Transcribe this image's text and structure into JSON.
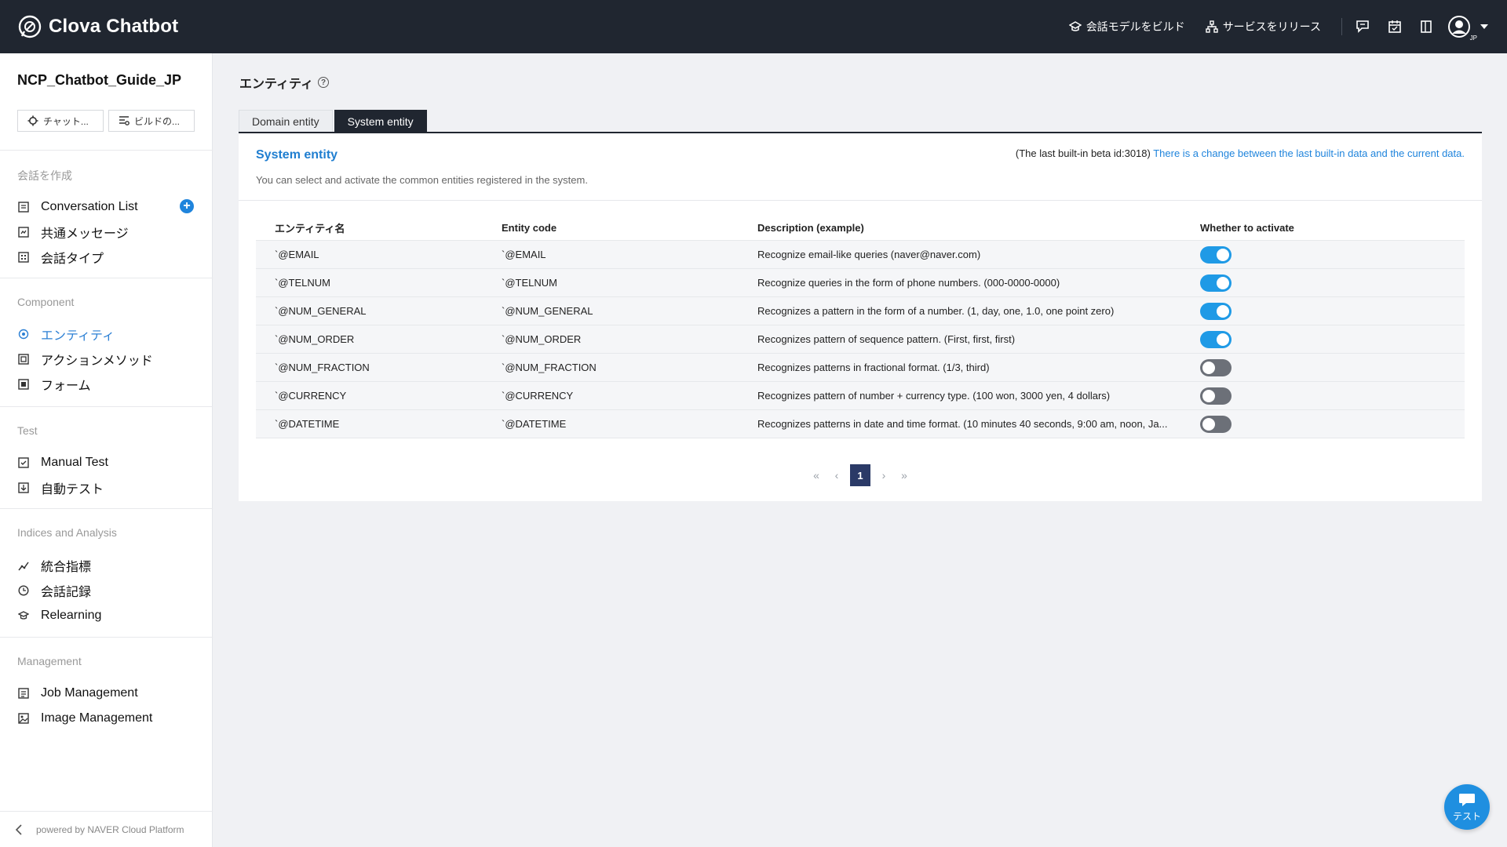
{
  "app": {
    "name": "Clova Chatbot"
  },
  "topbar": {
    "build_label": "会話モデルをビルド",
    "release_label": "サービスをリリース",
    "avatar_locale": "JP"
  },
  "sidebar": {
    "project_name": "NCP_Chatbot_Guide_JP",
    "buttons": {
      "chat": "チャット...",
      "build": "ビルドの..."
    },
    "sections": {
      "create": "会話を作成",
      "component": "Component",
      "test": "Test",
      "indices": "Indices and Analysis",
      "management": "Management"
    },
    "items": {
      "conversation_list": "Conversation List",
      "common_message": "共通メッセージ",
      "conversation_type": "会話タイプ",
      "entity": "エンティティ",
      "action_method": "アクションメソッド",
      "form": "フォーム",
      "manual_test": "Manual Test",
      "auto_test": "自動テスト",
      "integrated_index": "統合指標",
      "conversation_log": "会話記録",
      "relearning": "Relearning",
      "job_management": "Job Management",
      "image_management": "Image Management"
    },
    "footer": "powered by NAVER Cloud Platform"
  },
  "main": {
    "title": "エンティティ",
    "help": "?",
    "tabs": [
      "Domain entity",
      "System entity"
    ],
    "active_tab": "System entity",
    "panel": {
      "title": "System entity",
      "description": "You can select and activate the common entities registered in the system.",
      "note_prefix": "(The last built-in beta id:3018)",
      "note_link": "There is a change between the last built-in data and the current data."
    },
    "table": {
      "headers": [
        "エンティティ名",
        "Entity code",
        "Description (example)",
        "Whether to activate"
      ],
      "rows": [
        {
          "name": "`@EMAIL",
          "code": "`@EMAIL",
          "desc": "Recognize email-like queries (naver@naver.com)",
          "active": true
        },
        {
          "name": "`@TELNUM",
          "code": "`@TELNUM",
          "desc": "Recognize queries in the form of phone numbers. (000-0000-0000)",
          "active": true
        },
        {
          "name": "`@NUM_GENERAL",
          "code": "`@NUM_GENERAL",
          "desc": "Recognizes a pattern in the form of a number. (1, day, one, 1.0, one point zero)",
          "active": true
        },
        {
          "name": "`@NUM_ORDER",
          "code": "`@NUM_ORDER",
          "desc": "Recognizes pattern of sequence pattern. (First, first, first)",
          "active": true
        },
        {
          "name": "`@NUM_FRACTION",
          "code": "`@NUM_FRACTION",
          "desc": "Recognizes patterns in fractional format. (1/3, third)",
          "active": false
        },
        {
          "name": "`@CURRENCY",
          "code": "`@CURRENCY",
          "desc": "Recognizes pattern of number + currency type. (100 won, 3000 yen, 4 dollars)",
          "active": false
        },
        {
          "name": "`@DATETIME",
          "code": "`@DATETIME",
          "desc": "Recognizes patterns in date and time format. (10 minutes 40 seconds, 9:00 am, noon, Ja...",
          "active": false
        }
      ]
    },
    "pagination": {
      "first": "«",
      "prev": "‹",
      "current": "1",
      "next": "›",
      "last": "»"
    }
  },
  "fab": {
    "label": "テスト"
  },
  "colors": {
    "topbar": "#202630",
    "accent": "#1f84dc",
    "toggle_on": "#1f9ae6",
    "toggle_off": "#6c7078"
  }
}
